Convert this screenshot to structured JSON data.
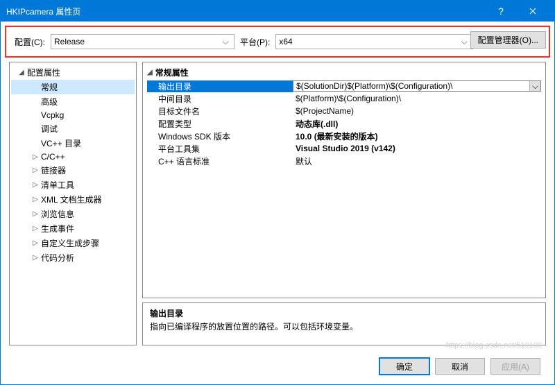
{
  "titlebar": {
    "title": "HKIPcamera 属性页"
  },
  "toolbar": {
    "config_label": "配置(C):",
    "config_value": "Release",
    "platform_label": "平台(P):",
    "platform_value": "x64",
    "manager_button": "配置管理器(O)..."
  },
  "tree": {
    "root": {
      "label": "配置属性",
      "expander": "◢"
    },
    "items": [
      {
        "label": "常规",
        "expander": "",
        "selected": true
      },
      {
        "label": "高级",
        "expander": ""
      },
      {
        "label": "Vcpkg",
        "expander": ""
      },
      {
        "label": "调试",
        "expander": ""
      },
      {
        "label": "VC++ 目录",
        "expander": ""
      },
      {
        "label": "C/C++",
        "expander": "▷"
      },
      {
        "label": "链接器",
        "expander": "▷"
      },
      {
        "label": "清单工具",
        "expander": "▷"
      },
      {
        "label": "XML 文档生成器",
        "expander": "▷"
      },
      {
        "label": "浏览信息",
        "expander": "▷"
      },
      {
        "label": "生成事件",
        "expander": "▷"
      },
      {
        "label": "自定义生成步骤",
        "expander": "▷"
      },
      {
        "label": "代码分析",
        "expander": "▷"
      }
    ]
  },
  "props": {
    "group_header": "常规属性",
    "group_exp": "◢",
    "rows": [
      {
        "name": "输出目录",
        "value": "$(SolutionDir)$(Platform)\\$(Configuration)\\",
        "selected": true,
        "bold": false
      },
      {
        "name": "中间目录",
        "value": "$(Platform)\\$(Configuration)\\",
        "bold": false
      },
      {
        "name": "目标文件名",
        "value": "$(ProjectName)",
        "bold": false
      },
      {
        "name": "配置类型",
        "value": "动态库(.dll)",
        "bold": true
      },
      {
        "name": "Windows SDK 版本",
        "value": "10.0 (最新安装的版本)",
        "bold": true
      },
      {
        "name": "平台工具集",
        "value": "Visual Studio 2019 (v142)",
        "bold": true
      },
      {
        "name": "C++ 语言标准",
        "value": "默认",
        "bold": false
      }
    ]
  },
  "description": {
    "title": "输出目录",
    "body": "指向已编译程序的放置位置的路径。可以包括环境变量。"
  },
  "footer": {
    "ok": "确定",
    "cancel": "取消",
    "apply": "应用(A)"
  },
  "dropdown_glyph": "⌵",
  "help_glyph": "?",
  "watermark": "https://blog.csdn.net/510100"
}
